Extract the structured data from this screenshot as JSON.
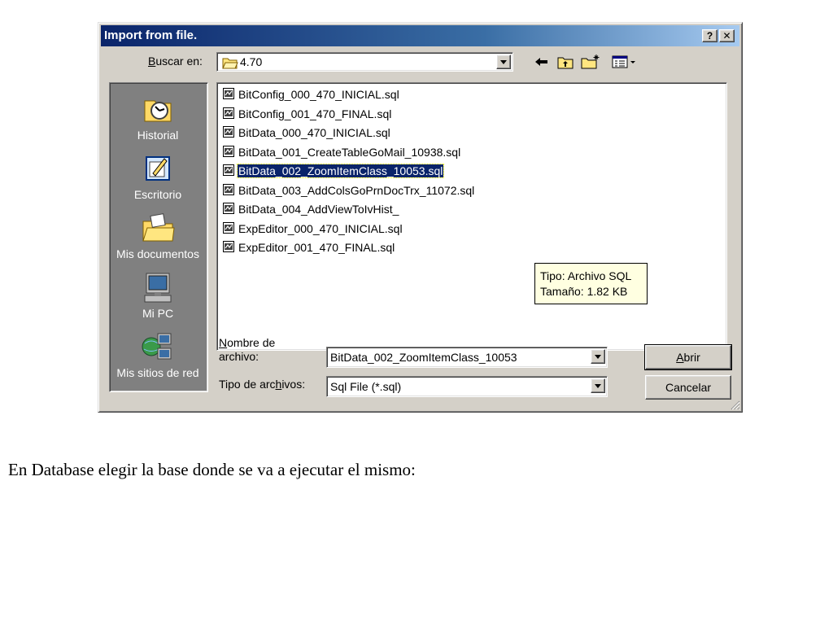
{
  "dialog": {
    "title": "Import from file.",
    "help_button": "?",
    "close_button": "✕"
  },
  "lookin": {
    "label_prefix": "",
    "label_accel": "B",
    "label_rest": "uscar en:",
    "value": "4.70"
  },
  "toolbar": {
    "icons": [
      "back-icon",
      "up-folder-icon",
      "new-folder-icon",
      "view-menu-icon"
    ]
  },
  "places": [
    {
      "label": "Historial",
      "icon": "history-icon"
    },
    {
      "label": "Escritorio",
      "icon": "desktop-icon"
    },
    {
      "label": "Mis documentos",
      "icon": "my-documents-icon"
    },
    {
      "label": "Mi PC",
      "icon": "my-computer-icon"
    },
    {
      "label": "Mis sitios de red",
      "icon": "network-places-icon"
    }
  ],
  "files": [
    "BitConfig_000_470_INICIAL.sql",
    "BitConfig_001_470_FINAL.sql",
    "BitData_000_470_INICIAL.sql",
    "BitData_001_CreateTableGoMail_10938.sql",
    "BitData_002_ZoomItemClass_10053.sql",
    "BitData_003_AddColsGoPrnDocTrx_11072.sql",
    "BitData_004_AddViewToIvHist_",
    "ExpEditor_000_470_INICIAL.sql",
    "ExpEditor_001_470_FINAL.sql"
  ],
  "selected_file_index": 4,
  "tooltip": {
    "line1": "Tipo: Archivo SQL",
    "line2": "Tamaño: 1.82 KB"
  },
  "filename": {
    "label_accel": "N",
    "label_rest": "ombre de",
    "label_line2": "archivo:",
    "value": "BitData_002_ZoomItemClass_10053"
  },
  "filetype": {
    "label_pre": "Tipo de arc",
    "label_accel": "h",
    "label_rest": "ivos:",
    "value": "Sql File (*.sql)"
  },
  "buttons": {
    "open_accel": "A",
    "open_rest": "brir",
    "cancel": "Cancelar"
  },
  "caption": "En Database elegir la base donde se va a ejecutar el mismo:",
  "colors": {
    "title_start": "#0a246a",
    "title_end": "#a6caf0",
    "face": "#d4d0c8",
    "places_bg": "#808080",
    "selection": "#0a246a",
    "tooltip_bg": "#ffffe1"
  }
}
